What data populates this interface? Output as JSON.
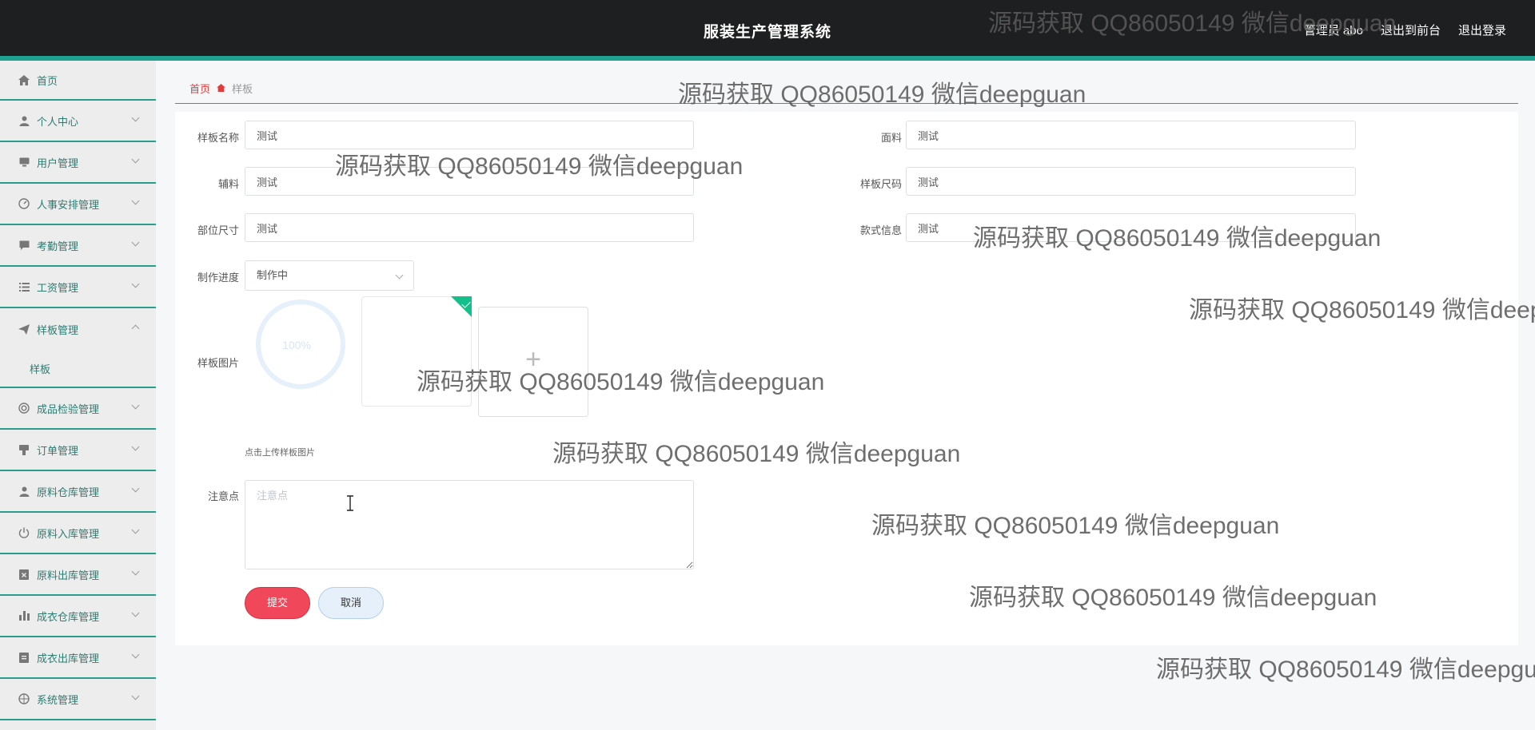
{
  "header": {
    "title": "服装生产管理系统",
    "user": "管理员 abo",
    "to_front": "退出到前台",
    "logout": "退出登录"
  },
  "sidebar": {
    "items": [
      {
        "label": "首页",
        "icon": "home-icon",
        "expandable": false
      },
      {
        "label": "个人中心",
        "icon": "user-icon",
        "expandable": true
      },
      {
        "label": "用户管理",
        "icon": "monitor-icon",
        "expandable": true
      },
      {
        "label": "人事安排管理",
        "icon": "dashboard-icon",
        "expandable": true
      },
      {
        "label": "考勤管理",
        "icon": "chat-icon",
        "expandable": true
      },
      {
        "label": "工资管理",
        "icon": "list-icon",
        "expandable": true
      },
      {
        "label": "样板管理",
        "icon": "send-icon",
        "expandable": true,
        "expanded": true
      },
      {
        "label": "成品检验管理",
        "icon": "lifebuoy-icon",
        "expandable": true
      },
      {
        "label": "订单管理",
        "icon": "stamp-icon",
        "expandable": true
      },
      {
        "label": "原料仓库管理",
        "icon": "user-icon",
        "expandable": true
      },
      {
        "label": "原料入库管理",
        "icon": "power-icon",
        "expandable": true
      },
      {
        "label": "原料出库管理",
        "icon": "clipboard-x-icon",
        "expandable": true
      },
      {
        "label": "成衣仓库管理",
        "icon": "bar-chart-icon",
        "expandable": true
      },
      {
        "label": "成衣出库管理",
        "icon": "clipboard-icon",
        "expandable": true
      },
      {
        "label": "系统管理",
        "icon": "compass-icon",
        "expandable": true
      }
    ],
    "sub_item": "样板"
  },
  "breadcrumb": {
    "home": "首页",
    "current": "样板"
  },
  "form": {
    "name_label": "样板名称",
    "name_value": "测试",
    "fabric_label": "面料",
    "fabric_value": "测试",
    "accessory_label": "辅料",
    "accessory_value": "测试",
    "size_label": "样板尺码",
    "size_value": "测试",
    "part_size_label": "部位尺寸",
    "part_size_value": "测试",
    "style_label": "款式信息",
    "style_value": "测试",
    "progress_label": "制作进度",
    "progress_value": "制作中",
    "image_label": "样板图片",
    "upload_percent": "100%",
    "upload_hint": "点击上传样板图片",
    "note_label": "注意点",
    "note_placeholder": "注意点",
    "submit": "提交",
    "cancel": "取消"
  },
  "watermark": "源码获取 QQ86050149 微信deepguan",
  "colors": {
    "accent": "#2c9c8c",
    "header_bg": "#1e1f21",
    "submit": "#f1475a",
    "breadcrumb_home": "#e6393b"
  }
}
